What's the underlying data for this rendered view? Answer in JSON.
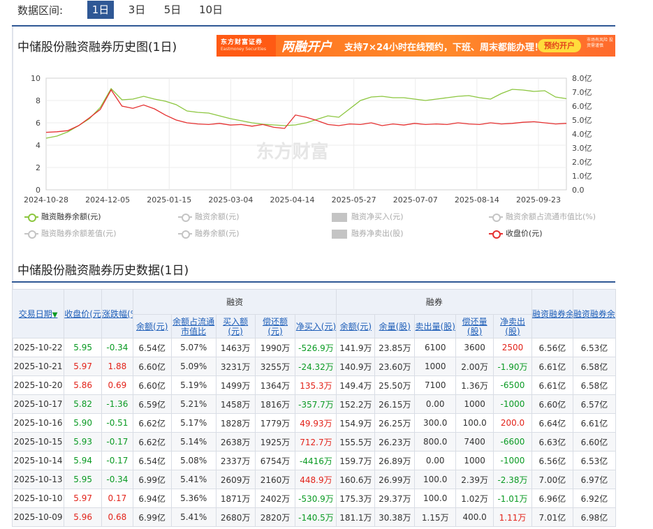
{
  "range_selector": {
    "label": "数据区间:",
    "options": [
      "1日",
      "3日",
      "5日",
      "10日"
    ],
    "active": "1日"
  },
  "chart_section": {
    "title": "中储股份融资融券历史图(1日)"
  },
  "banner": {
    "logo": "东方财富证券",
    "logo_sub": "Eastmoney Securities",
    "headline": "两融开户",
    "text": "支持7×24小时在线预约，下班、周末都能办理！",
    "button": "预约开户",
    "tail": "市场有风险 投资需谨慎"
  },
  "colors": {
    "accent": "#2f5895",
    "margin_balance": "#8cc63f",
    "close_price": "#e53030",
    "up": "#e2231a",
    "down": "#0a9a23"
  },
  "watermark": "东方财富",
  "chart_data": {
    "type": "line",
    "x_ticks": [
      "2024-10-28",
      "2024-12-05",
      "2025-01-15",
      "2025-03-04",
      "2025-04-14",
      "2025-05-27",
      "2025-07-07",
      "2025-08-14",
      "2025-09-23"
    ],
    "y_left": {
      "ticks": [
        "0",
        "2",
        "4",
        "6",
        "8",
        "10"
      ],
      "range": [
        0,
        10
      ]
    },
    "y_right": {
      "ticks": [
        "0.0",
        "1.0亿",
        "2.0亿",
        "3.0亿",
        "4.0亿",
        "5.0亿",
        "6.0亿",
        "7.0亿",
        "8.0亿"
      ],
      "range": [
        0,
        8
      ]
    },
    "grid": true,
    "series": [
      {
        "name": "融资融券余额(元)",
        "axis": "right",
        "color": "#8cc63f",
        "values": [
          3.7,
          3.85,
          4.15,
          4.6,
          5.1,
          5.9,
          7.25,
          6.45,
          6.5,
          6.7,
          6.5,
          6.35,
          6.1,
          5.65,
          5.55,
          5.5,
          5.3,
          5.1,
          4.95,
          4.8,
          4.7,
          4.65,
          4.6,
          4.65,
          4.8,
          5.05,
          5.3,
          5.2,
          5.8,
          6.4,
          6.65,
          6.7,
          6.6,
          6.6,
          6.5,
          6.4,
          6.5,
          6.6,
          6.7,
          6.75,
          6.6,
          6.5,
          6.9,
          7.2,
          7.15,
          7.05,
          7.1,
          6.65,
          6.53
        ]
      },
      {
        "name": "收盘价(元)",
        "axis": "left",
        "color": "#e53030",
        "values": [
          5.15,
          5.2,
          5.3,
          5.75,
          6.45,
          7.2,
          8.95,
          7.5,
          7.3,
          7.6,
          7.25,
          6.7,
          6.25,
          6.0,
          5.9,
          5.85,
          5.95,
          5.8,
          5.85,
          5.7,
          5.85,
          5.6,
          5.5,
          6.7,
          6.5,
          6.2,
          5.85,
          5.75,
          5.9,
          5.85,
          6.0,
          5.75,
          5.9,
          5.8,
          5.95,
          5.85,
          5.9,
          5.85,
          6.0,
          5.9,
          5.85,
          6.0,
          5.9,
          5.95,
          6.05,
          6.1,
          6.0,
          5.9,
          5.95
        ]
      }
    ]
  },
  "legend": [
    {
      "label": "融资融券余额(元)",
      "type": "line",
      "active": true,
      "color": "#8cc63f"
    },
    {
      "label": "融资余额(元)",
      "type": "line",
      "active": false,
      "color": "#c4c4c4"
    },
    {
      "label": "融资净买入(元)",
      "type": "bar",
      "active": false,
      "color": "#c4c4c4"
    },
    {
      "label": "融资余额占流通市值比(%)",
      "type": "line",
      "active": false,
      "color": "#c4c4c4"
    },
    {
      "label": "融资融券余额差值(元)",
      "type": "line",
      "active": false,
      "color": "#c4c4c4"
    },
    {
      "label": "融券余额(元)",
      "type": "line",
      "active": false,
      "color": "#c4c4c4"
    },
    {
      "label": "融券净卖出(股)",
      "type": "bar",
      "active": false,
      "color": "#c4c4c4"
    },
    {
      "label": "收盘价(元)",
      "type": "line",
      "active": true,
      "color": "#e53030"
    }
  ],
  "table_section": {
    "title": "中储股份融资融券历史数据(1日)"
  },
  "table": {
    "group_headers": {
      "financing": "融资",
      "lending": "融券"
    },
    "headers": {
      "date": "交易日期",
      "close": "收盘价(元)",
      "change": "涨跌幅(%)",
      "fin_balance": "余额(元)",
      "fin_ratio": "余额占流通市值比",
      "fin_buy": "买入额(元)",
      "fin_repay": "偿还额(元)",
      "fin_net": "净买入(元)",
      "lend_balance": "余额(元)",
      "lend_volume": "余量(股)",
      "lend_sell": "卖出量(股)",
      "lend_repay": "偿还量(股)",
      "lend_net": "净卖出(股)",
      "total_balance": "融资融券余额(元)",
      "diff": "融资融券余额差值(元)"
    },
    "rows": [
      [
        "2025-10-22",
        "5.95",
        "-0.34",
        "6.54亿",
        "5.07%",
        "1463万",
        "1990万",
        "-526.9万",
        "141.9万",
        "23.85万",
        "6100",
        "3600",
        "2500",
        "6.56亿",
        "6.53亿"
      ],
      [
        "2025-10-21",
        "5.97",
        "1.88",
        "6.60亿",
        "5.09%",
        "3231万",
        "3255万",
        "-24.32万",
        "140.9万",
        "23.60万",
        "1000",
        "2.00万",
        "-1.90万",
        "6.61亿",
        "6.58亿"
      ],
      [
        "2025-10-20",
        "5.86",
        "0.69",
        "6.60亿",
        "5.19%",
        "1499万",
        "1364万",
        "135.3万",
        "149.4万",
        "25.50万",
        "7100",
        "1.36万",
        "-6500",
        "6.61亿",
        "6.58亿"
      ],
      [
        "2025-10-17",
        "5.82",
        "-1.36",
        "6.59亿",
        "5.21%",
        "1458万",
        "1816万",
        "-357.7万",
        "152.2万",
        "26.15万",
        "0.00",
        "1000",
        "-1000",
        "6.60亿",
        "6.57亿"
      ],
      [
        "2025-10-16",
        "5.90",
        "-0.51",
        "6.62亿",
        "5.17%",
        "1828万",
        "1779万",
        "49.93万",
        "154.9万",
        "26.25万",
        "300.0",
        "100.0",
        "200.0",
        "6.64亿",
        "6.61亿"
      ],
      [
        "2025-10-15",
        "5.93",
        "-0.17",
        "6.62亿",
        "5.14%",
        "2638万",
        "1925万",
        "712.7万",
        "155.5万",
        "26.23万",
        "800.0",
        "7400",
        "-6600",
        "6.63亿",
        "6.60亿"
      ],
      [
        "2025-10-14",
        "5.94",
        "-0.17",
        "6.54亿",
        "5.08%",
        "2337万",
        "6754万",
        "-4416万",
        "159.7万",
        "26.89万",
        "0.00",
        "1000",
        "-1000",
        "6.56亿",
        "6.53亿"
      ],
      [
        "2025-10-13",
        "5.95",
        "-0.34",
        "6.99亿",
        "5.41%",
        "2609万",
        "2160万",
        "448.9万",
        "160.6万",
        "26.99万",
        "100.0",
        "2.39万",
        "-2.38万",
        "7.00亿",
        "6.97亿"
      ],
      [
        "2025-10-10",
        "5.97",
        "0.17",
        "6.94亿",
        "5.36%",
        "1871万",
        "2402万",
        "-530.9万",
        "175.3万",
        "29.37万",
        "100.0",
        "1.02万",
        "-1.01万",
        "6.96亿",
        "6.92亿"
      ],
      [
        "2025-10-09",
        "5.96",
        "0.68",
        "6.99亿",
        "5.41%",
        "2680万",
        "2820万",
        "-140.5万",
        "181.1万",
        "30.38万",
        "1.15万",
        "400.0",
        "1.11万",
        "7.01亿",
        "6.98亿"
      ]
    ]
  }
}
